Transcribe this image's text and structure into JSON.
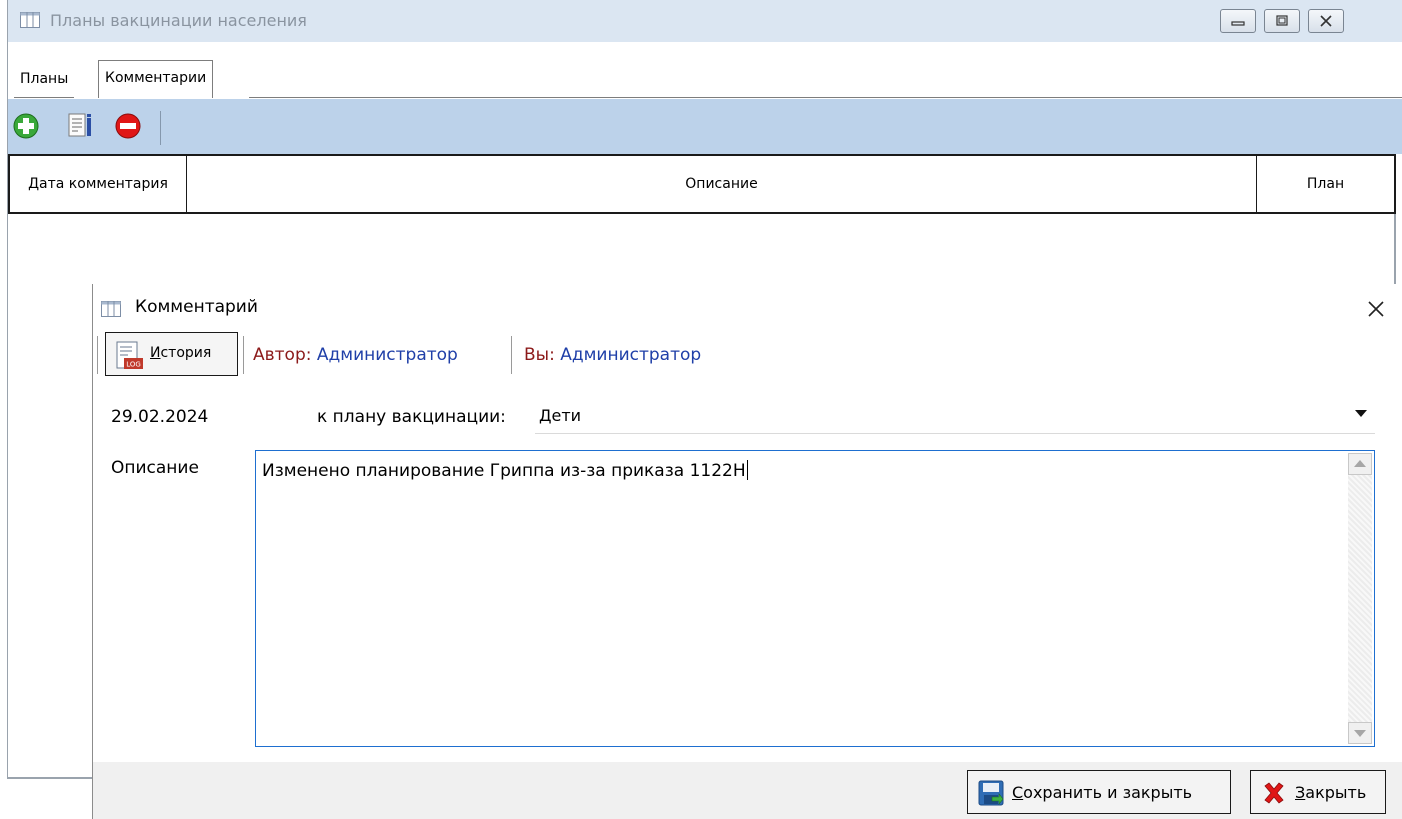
{
  "main_window": {
    "title": "Планы вакцинации населения",
    "tabs": [
      {
        "label": "Планы"
      },
      {
        "label": "Комментарии"
      }
    ],
    "toolbar": {
      "icons": [
        "add-icon",
        "edit-icon",
        "delete-icon"
      ]
    },
    "grid": {
      "columns": [
        "Дата комментария",
        "Описание",
        "План"
      ]
    }
  },
  "dialog": {
    "title": "Комментарий",
    "history_button": {
      "underlined_char": "И",
      "rest": "стория"
    },
    "author_prefix": "Автор: ",
    "author_name": "Администратор",
    "you_prefix": "Вы: ",
    "you_name": "Администратор",
    "date": "29.02.2024",
    "plan_label": "к плану вакцинации:",
    "plan_value": "Дети",
    "description_label": "Описание",
    "description_text": "Изменено планирование Гриппа из-за приказа 1122Н",
    "save_button": {
      "underlined_char": "С",
      "rest": "охранить и закрыть"
    },
    "close_button": {
      "underlined_char": "З",
      "rest": "акрыть"
    }
  },
  "colors": {
    "toolbar_bg": "#bcd2ea",
    "titlebar_bg": "#dbe6f2",
    "author_label": "#8c1a1a",
    "author_name": "#1f3fa8",
    "focus_border": "#1e6fd0"
  }
}
